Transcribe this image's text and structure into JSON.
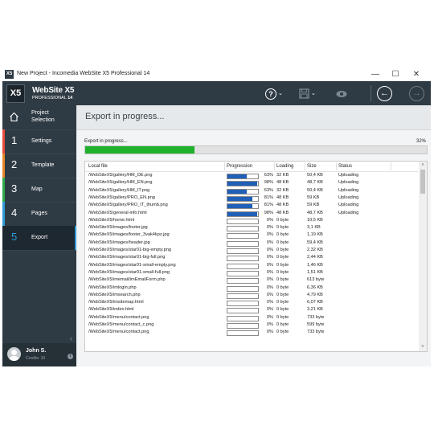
{
  "window": {
    "title": "New Project - Incomedia WebSite X5 Professional 14",
    "app_icon": "X5",
    "minimize": "—",
    "maximize": "☐",
    "close": "✕"
  },
  "header": {
    "logo": "X5",
    "brand": "WebSite X5",
    "edition_prefix": "PROFESSIONAL",
    "edition_version": "14",
    "help_icon": "?",
    "save_icon": "💾",
    "preview_icon": "👁",
    "back_icon": "←",
    "forward_icon": "→",
    "chevron": "⌄"
  },
  "sidebar": {
    "home_label_1": "Project",
    "home_label_2": "Selection",
    "items": [
      {
        "num": "1",
        "label": "Settings",
        "color": "#e84a3c"
      },
      {
        "num": "2",
        "label": "Template",
        "color": "#e8872a"
      },
      {
        "num": "3",
        "label": "Map",
        "color": "#2eaa4a"
      },
      {
        "num": "4",
        "label": "Pages",
        "color": "#2f9bd8"
      },
      {
        "num": "5",
        "label": "Export",
        "color": "#2f9bd8"
      }
    ],
    "collapse": "‹",
    "user_name": "John S.",
    "user_credit": "Credits: 10",
    "info": "i"
  },
  "main": {
    "title": "Export in progress...",
    "progress_label": "Export in progress...",
    "progress_pct_text": "32%",
    "progress_value": 0.32,
    "columns": [
      "Local file",
      "Progression",
      "Loading",
      "Size",
      "Status"
    ],
    "rows": [
      {
        "file": "/WebSiteX5/gallery/HM_DE.png",
        "pct": "63%",
        "p": 0.63,
        "load": "32 KB",
        "size": "50,4 KB",
        "status": "Uploading"
      },
      {
        "file": "/WebSiteX5/gallery/HM_EN.png",
        "pct": "98%",
        "p": 0.98,
        "load": "48 KB",
        "size": "48,7 KB",
        "status": "Uploading"
      },
      {
        "file": "/WebSiteX5/gallery/HM_IT.png",
        "pct": "63%",
        "p": 0.63,
        "load": "32 KB",
        "size": "50,4 KB",
        "status": "Uploading"
      },
      {
        "file": "/WebSiteX5/gallery/PRO_EN.png",
        "pct": "81%",
        "p": 0.81,
        "load": "48 KB",
        "size": "59 KB",
        "status": "Uploading"
      },
      {
        "file": "/WebSiteX5/gallery/PRO_IT_thumb.png",
        "pct": "81%",
        "p": 0.81,
        "load": "48 KB",
        "size": "59 KB",
        "status": "Uploading"
      },
      {
        "file": "/WebSiteX5/general-info.html",
        "pct": "98%",
        "p": 0.98,
        "load": "48 KB",
        "size": "48,7 KB",
        "status": "Uploading"
      },
      {
        "file": "/WebSiteX5/home.html",
        "pct": "0%",
        "p": 0,
        "load": "0 byte",
        "size": "10,5 KB",
        "status": ""
      },
      {
        "file": "/WebSiteX5/images/footer.jpg",
        "pct": "0%",
        "p": 0,
        "load": "0 byte",
        "size": "3,1 KB",
        "status": ""
      },
      {
        "file": "/WebSiteX5/images/footer_3vak4kpz.jpg",
        "pct": "0%",
        "p": 0,
        "load": "0 byte",
        "size": "1,19 KB",
        "status": ""
      },
      {
        "file": "/WebSiteX5/images/header.jpg",
        "pct": "0%",
        "p": 0,
        "load": "0 byte",
        "size": "59,4 KB",
        "status": ""
      },
      {
        "file": "/WebSiteX5/images/star01-big-empty.png",
        "pct": "0%",
        "p": 0,
        "load": "0 byte",
        "size": "2,32 KB",
        "status": ""
      },
      {
        "file": "/WebSiteX5/images/star01-big-full.png",
        "pct": "0%",
        "p": 0,
        "load": "0 byte",
        "size": "2,44 KB",
        "status": ""
      },
      {
        "file": "/WebSiteX5/images/star01-small-empty.png",
        "pct": "0%",
        "p": 0,
        "load": "0 byte",
        "size": "1,46 KB",
        "status": ""
      },
      {
        "file": "/WebSiteX5/images/star01-small-full.png",
        "pct": "0%",
        "p": 0,
        "load": "0 byte",
        "size": "1,51 KB",
        "status": ""
      },
      {
        "file": "/WebSiteX5/imemail/imEmailForm.php",
        "pct": "0%",
        "p": 0,
        "load": "0 byte",
        "size": "613 byte",
        "status": ""
      },
      {
        "file": "/WebSiteX5/imlogin.php",
        "pct": "0%",
        "p": 0,
        "load": "0 byte",
        "size": "6,36 KB",
        "status": ""
      },
      {
        "file": "/WebSiteX5/imsearch.php",
        "pct": "0%",
        "p": 0,
        "load": "0 byte",
        "size": "4,79 KB",
        "status": ""
      },
      {
        "file": "/WebSiteX5/imsitemap.html",
        "pct": "0%",
        "p": 0,
        "load": "0 byte",
        "size": "6,07 KB",
        "status": ""
      },
      {
        "file": "/WebSiteX5/index.html",
        "pct": "0%",
        "p": 0,
        "load": "0 byte",
        "size": "3,21 KB",
        "status": ""
      },
      {
        "file": "/WebSiteX5/menu/contact.png",
        "pct": "0%",
        "p": 0,
        "load": "0 byte",
        "size": "733 byte",
        "status": ""
      },
      {
        "file": "/WebSiteX5/menu/contact_c.png",
        "pct": "0%",
        "p": 0,
        "load": "0 byte",
        "size": "599 byte",
        "status": ""
      },
      {
        "file": "/WebSiteX5/menu/contact.png",
        "pct": "0%",
        "p": 0,
        "load": "0 byte",
        "size": "733 byte",
        "status": ""
      }
    ],
    "scroll_up": "˄",
    "scroll_down": "˅"
  }
}
